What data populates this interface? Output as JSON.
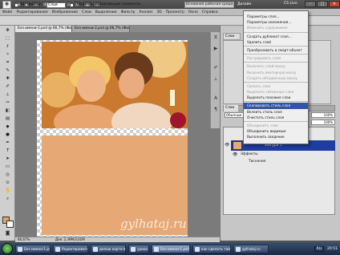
{
  "window": {
    "logo": "Ps",
    "zoom_label": "66,7",
    "workspace_essentials": "Основная рабочая среда",
    "workspace_design": "Дизайн",
    "cs_live": "CS Live"
  },
  "menubar": [
    "Файл",
    "Редактирование",
    "Изображение",
    "Слои",
    "Выделение",
    "Фильтр",
    "Анализ",
    "3D",
    "Просмотр",
    "Окно",
    "Справка"
  ],
  "options": {
    "autoselect_label": "Автовыбор:",
    "autoselect_value": "Слой",
    "transform_label": "Показать управляющие элементы"
  },
  "tabs": [
    "Без имени-1.psd @ 66,7% (Фигура 1, RGB/8) *",
    "Без имени-2.psd @ 66,7% (Фигура 1, RGB/8) *"
  ],
  "status": {
    "zoom": "66,67%",
    "doc": "Док: 2,39M/3,01M"
  },
  "watermark": "gylhataj.ru",
  "panels": {
    "panel_tab": "Слои",
    "layers_tab": "Слои",
    "blend_mode": "Обычные",
    "opacity": "100%",
    "fill": "100%",
    "layer_name": "Фигура 1",
    "effects_label": "Эффекты",
    "stroke_label": "Тиснение"
  },
  "context_menu": [
    {
      "label": "Параметры слоя...",
      "state": "normal"
    },
    {
      "label": "Параметры наложения...",
      "state": "normal"
    },
    {
      "label": "Изменить содержимое",
      "state": "disabled"
    },
    {
      "sep": true
    },
    {
      "label": "Создать дубликат слоя...",
      "state": "normal"
    },
    {
      "label": "Удалить слой",
      "state": "normal"
    },
    {
      "sep": true
    },
    {
      "label": "Преобразовать в смарт-объект",
      "state": "normal"
    },
    {
      "sep": true
    },
    {
      "label": "Растрировать слой",
      "state": "disabled"
    },
    {
      "sep": true
    },
    {
      "label": "Включить слой-маску",
      "state": "disabled"
    },
    {
      "label": "Включить векторную маску",
      "state": "disabled"
    },
    {
      "label": "Создать обтравочную маску",
      "state": "disabled"
    },
    {
      "sep": true
    },
    {
      "label": "Связать слои",
      "state": "disabled"
    },
    {
      "label": "Выделить связанные слои",
      "state": "disabled"
    },
    {
      "label": "Выделить похожие слои",
      "state": "normal"
    },
    {
      "sep": true
    },
    {
      "label": "Скопировать стиль слоя",
      "state": "highlight"
    },
    {
      "label": "Вклеить стиль слоя",
      "state": "normal"
    },
    {
      "label": "Очистить стиль слоя",
      "state": "normal"
    },
    {
      "sep": true
    },
    {
      "label": "Объединить слои",
      "state": "disabled"
    },
    {
      "label": "Объединить видимые",
      "state": "normal"
    },
    {
      "label": "Выполнить сведение",
      "state": "normal"
    }
  ],
  "taskbar": {
    "items": [
      "Без имени-1.psd ...",
      "Редактировать с...",
      "делаю карточк...",
      "уроки",
      "Без имени-1.psd ...",
      "как сделать тамб...",
      "gylhataj.ru"
    ],
    "active_index": 4,
    "lang": "RU",
    "clock": "20:51"
  }
}
